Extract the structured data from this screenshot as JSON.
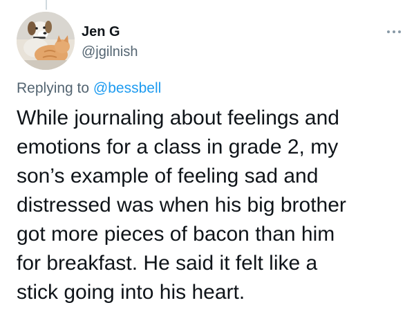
{
  "tweet": {
    "author": {
      "display_name": "Jen G",
      "handle": "@jgilnish",
      "avatar_icon": "dog-and-cat-photo"
    },
    "more_icon": "more-horizontal-icon",
    "reply": {
      "prefix": "Replying to",
      "mention": "@bessbell"
    },
    "text": "While journaling about feelings and\nemotions for a class in grade 2, my\nson’s example of feeling sad and\ndistressed was when his big brother\ngot more pieces of bacon than him\nfor breakfast.  He said it felt like a\nstick going into his heart."
  },
  "colors": {
    "text": "#0f1419",
    "secondary": "#536471",
    "link": "#1d9bf0"
  }
}
